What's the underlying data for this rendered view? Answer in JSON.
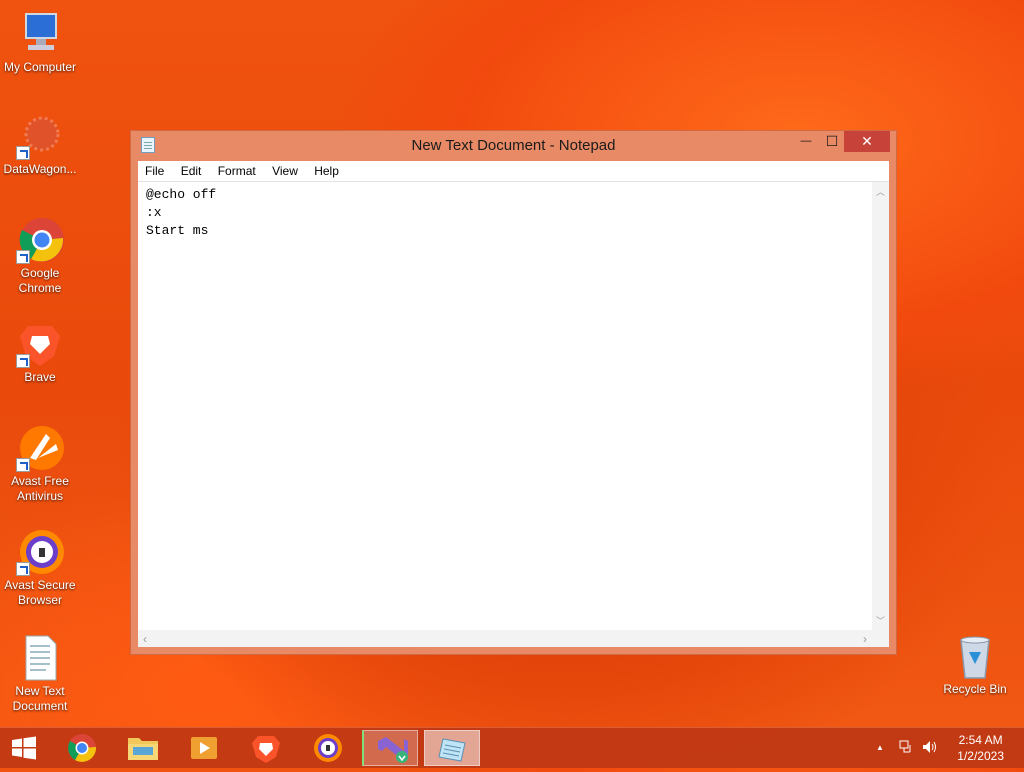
{
  "desktop": {
    "icons": [
      {
        "label": "My Computer"
      },
      {
        "label": "DataWagon..."
      },
      {
        "label": "Google Chrome"
      },
      {
        "label": "Brave"
      },
      {
        "label": "Avast Free Antivirus"
      },
      {
        "label": "Avast Secure Browser"
      },
      {
        "label": "New Text Document"
      },
      {
        "label": "Recycle Bin"
      }
    ]
  },
  "notepad": {
    "title": "New Text Document - Notepad",
    "menu": [
      "File",
      "Edit",
      "Format",
      "View",
      "Help"
    ],
    "content": "@echo off\n:x\nStart ms",
    "close_glyph": "✕",
    "minimize_glyph": "—",
    "maximize_glyph": "☐"
  },
  "taskbar": {
    "time": "2:54 AM",
    "date": "1/2/2023",
    "tray_up_arrow": "▲"
  },
  "colors": {
    "accent": "#c7433a",
    "window_frame": "#e88a66"
  }
}
